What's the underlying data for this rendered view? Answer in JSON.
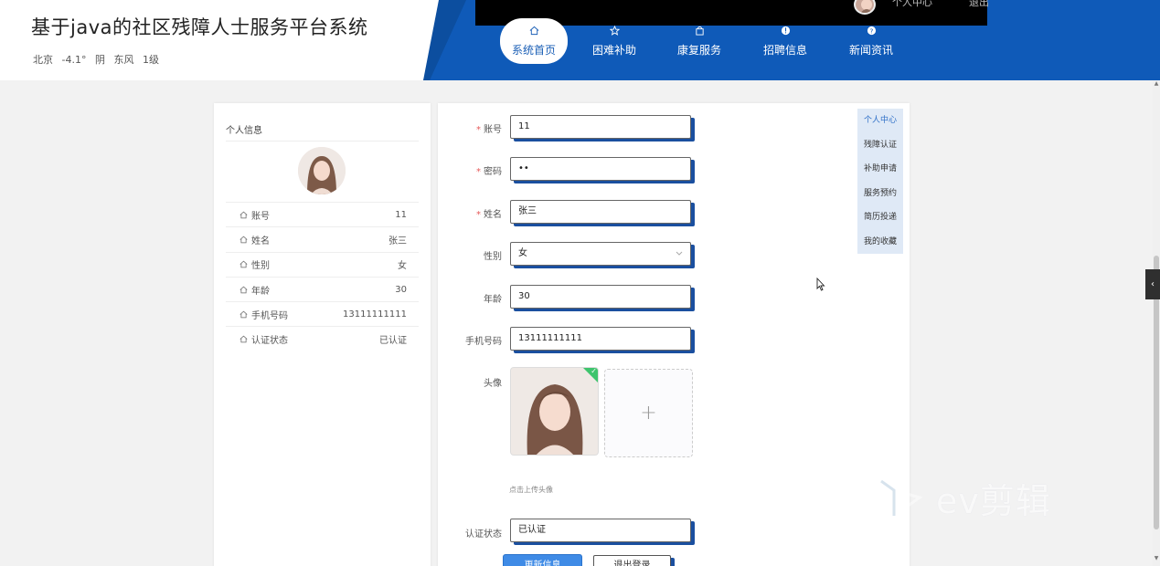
{
  "header": {
    "title": "基于java的社区残障人士服务平台系统",
    "weather": {
      "city": "北京",
      "temp": "-4.1°",
      "condition": "阴",
      "wind": "东风",
      "level": "1级"
    },
    "top_user": {
      "name": "个人中心",
      "logout": "退出"
    },
    "nav": [
      {
        "label": "系统首页",
        "icon": "home-icon"
      },
      {
        "label": "困难补助",
        "icon": "star-icon"
      },
      {
        "label": "康复服务",
        "icon": "bag-icon"
      },
      {
        "label": "招聘信息",
        "icon": "info-icon"
      },
      {
        "label": "新闻资讯",
        "icon": "question-icon"
      }
    ],
    "colors": {
      "brand_blue": "#0f5ab8",
      "accent": "#1b5fb6"
    }
  },
  "profile": {
    "title": "个人信息",
    "rows": [
      {
        "key": "账号",
        "value": "11"
      },
      {
        "key": "姓名",
        "value": "张三"
      },
      {
        "key": "性别",
        "value": "女"
      },
      {
        "key": "年龄",
        "value": "30"
      },
      {
        "key": "手机号码",
        "value": "13111111111"
      },
      {
        "key": "认证状态",
        "value": "已认证"
      }
    ]
  },
  "form": {
    "account_label": "账号",
    "account_value": "11",
    "password_label": "密码",
    "password_value": "••",
    "name_label": "姓名",
    "name_value": "张三",
    "gender_label": "性别",
    "gender_value": "女",
    "age_label": "年龄",
    "age_value": "30",
    "phone_label": "手机号码",
    "phone_value": "13111111111",
    "avatar_label": "头像",
    "avatar_tip": "点击上传头像",
    "add_symbol": "+",
    "status_label": "认证状态",
    "status_value": "已认证",
    "update_button": "更新信息",
    "logout_button": "退出登录"
  },
  "side_menu": [
    "个人中心",
    "残障认证",
    "补助申请",
    "服务预约",
    "简历投递",
    "我的收藏"
  ],
  "watermark": "ev剪辑"
}
